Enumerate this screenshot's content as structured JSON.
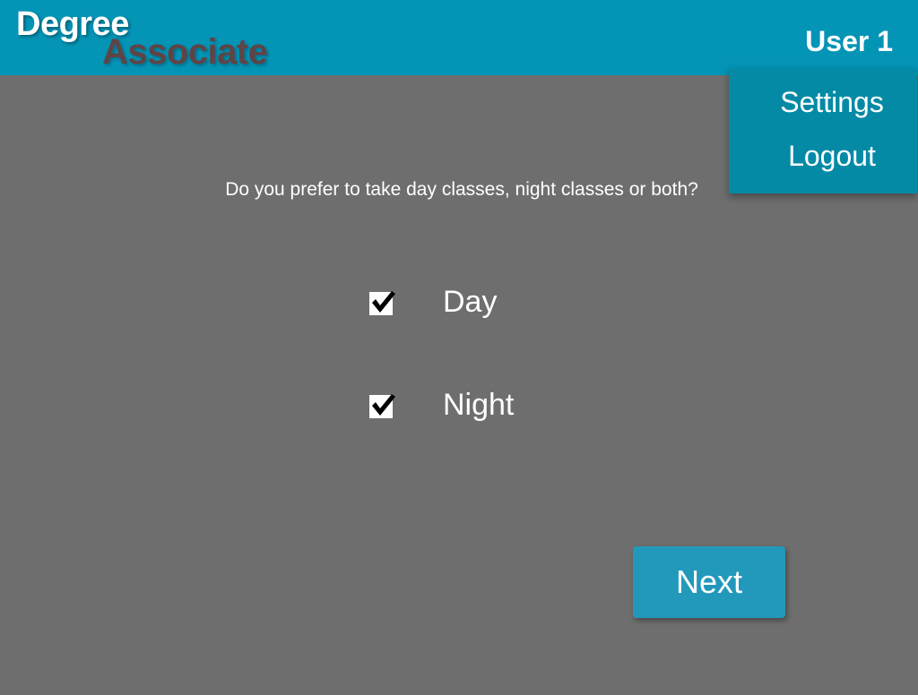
{
  "header": {
    "logo": {
      "line1": "Degree",
      "line2": "Associate"
    },
    "user_label": "User 1"
  },
  "user_menu": {
    "items": [
      {
        "label": "Settings"
      },
      {
        "label": "Logout"
      }
    ]
  },
  "question": {
    "text": "Do you prefer to take day classes, night classes or both?",
    "options": [
      {
        "label": "Day",
        "checked": true,
        "icon": "checkmark-icon"
      },
      {
        "label": "Night",
        "checked": true,
        "icon": "checkmark-icon"
      }
    ]
  },
  "actions": {
    "next_label": "Next"
  },
  "colors": {
    "header_bg": "#0494b6",
    "page_bg": "#6e6e6e",
    "dropdown_bg": "#058aa6",
    "button_bg": "#2299bb",
    "logo_secondary": "#5f4446"
  }
}
